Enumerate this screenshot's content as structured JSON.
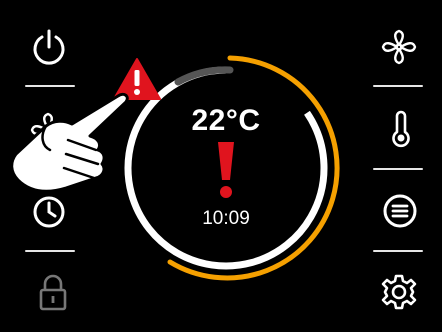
{
  "thermostat": {
    "temperature": "22°C",
    "time": "10:09"
  },
  "colors": {
    "background": "#000000",
    "accent": "#f5a000",
    "alert": "#e0141e",
    "foreground": "#ffffff"
  },
  "icons": {
    "left": [
      "power-icon",
      "fan-icon",
      "clock-icon",
      "lock-icon"
    ],
    "right": [
      "fan-icon",
      "thermometer-icon",
      "menu-icon",
      "gear-icon"
    ]
  }
}
